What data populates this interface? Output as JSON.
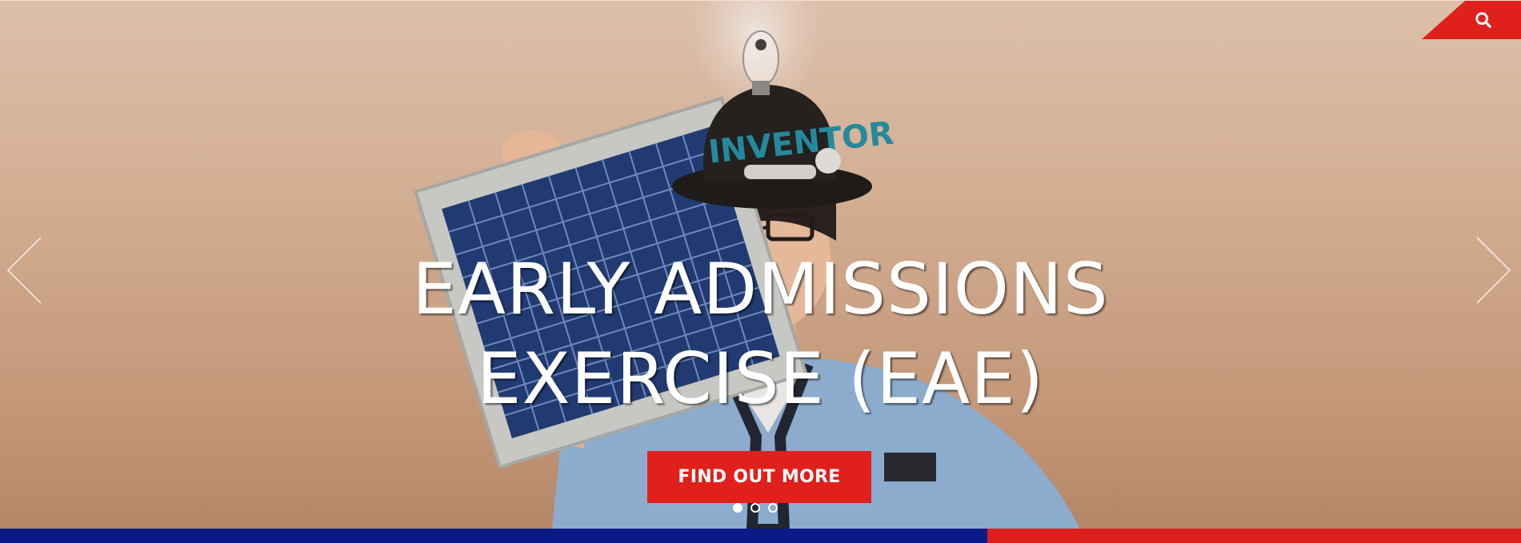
{
  "header": {
    "search_icon": "search-icon",
    "search_tab_color": "#e0201b"
  },
  "slider": {
    "headline_line1": "EARLY ADMISSIONS",
    "headline_line2": "EXERCISE (EAE)",
    "cta_label": "FIND OUT MORE",
    "cta_color": "#e0201b",
    "prev_icon": "chevron-left-icon",
    "next_icon": "chevron-right-icon",
    "slide_count": 3,
    "active_slide": 1,
    "image_text": {
      "hat_label": "INVENTOR"
    }
  },
  "footer_bar": {
    "colors": [
      "#0a1a86",
      "#dc1f1c"
    ]
  }
}
